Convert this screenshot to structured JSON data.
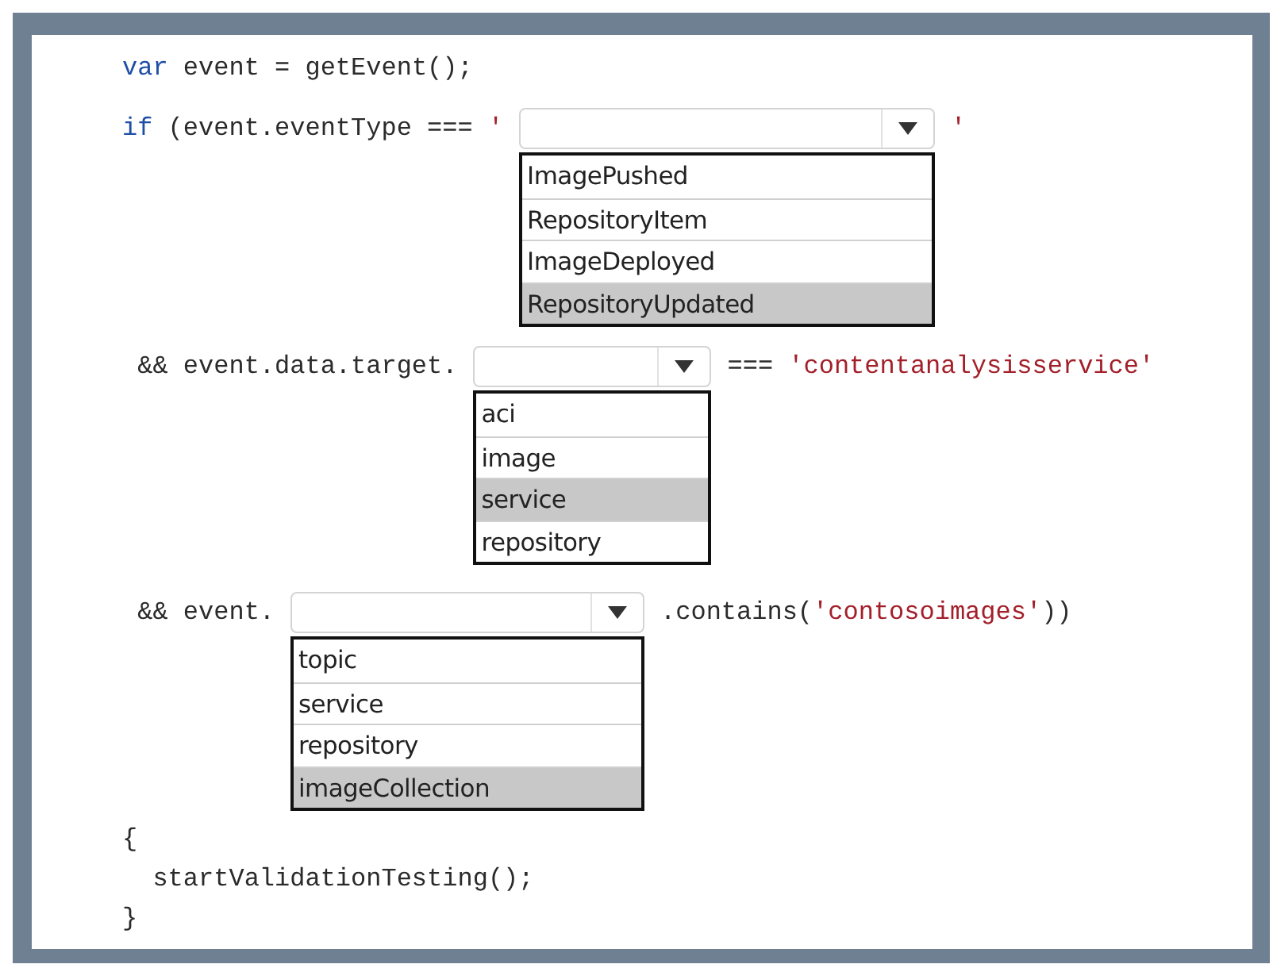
{
  "lines": [
    {
      "kind": "code",
      "tokens": [
        {
          "kind": "keyword",
          "text": "var"
        },
        {
          "kind": "plain",
          "text": " event = getEvent();"
        }
      ]
    },
    {
      "kind": "choice",
      "before": [
        {
          "kind": "keyword",
          "text": "if"
        },
        {
          "kind": "plain",
          "text": " (event.eventType === "
        },
        {
          "kind": "string",
          "text": "'"
        }
      ],
      "dropdown": {
        "options": [
          {
            "label": "ImagePushed",
            "selected": false
          },
          {
            "label": "RepositoryItem",
            "selected": false
          },
          {
            "label": "ImageDeployed",
            "selected": false
          },
          {
            "label": "RepositoryUpdated",
            "selected": true
          }
        ]
      },
      "after": [
        {
          "kind": "string",
          "text": "'"
        }
      ]
    },
    {
      "kind": "choice",
      "before": [
        {
          "kind": "plain",
          "text": " && event.data.target."
        }
      ],
      "dropdown": {
        "options": [
          {
            "label": "aci",
            "selected": false
          },
          {
            "label": "image",
            "selected": false
          },
          {
            "label": "service",
            "selected": true
          },
          {
            "label": "repository",
            "selected": false
          }
        ]
      },
      "after": [
        {
          "kind": "plain",
          "text": "=== "
        },
        {
          "kind": "string",
          "text": "'contentanalysisservice'"
        }
      ]
    },
    {
      "kind": "choice",
      "before": [
        {
          "kind": "plain",
          "text": " && event."
        }
      ],
      "dropdown": {
        "options": [
          {
            "label": "topic",
            "selected": false
          },
          {
            "label": "service",
            "selected": false
          },
          {
            "label": "repository",
            "selected": false
          },
          {
            "label": "imageCollection",
            "selected": true
          }
        ]
      },
      "after": [
        {
          "kind": "plain",
          "text": ".contains("
        },
        {
          "kind": "string",
          "text": "'contosoimages'"
        },
        {
          "kind": "plain",
          "text": "))"
        }
      ]
    },
    {
      "kind": "code",
      "tokens": [
        {
          "kind": "plain",
          "text": "{"
        }
      ]
    },
    {
      "kind": "code",
      "tokens": [
        {
          "kind": "plain",
          "text": "  startValidationTesting();"
        }
      ]
    },
    {
      "kind": "code",
      "tokens": [
        {
          "kind": "plain",
          "text": "}"
        }
      ]
    }
  ]
}
